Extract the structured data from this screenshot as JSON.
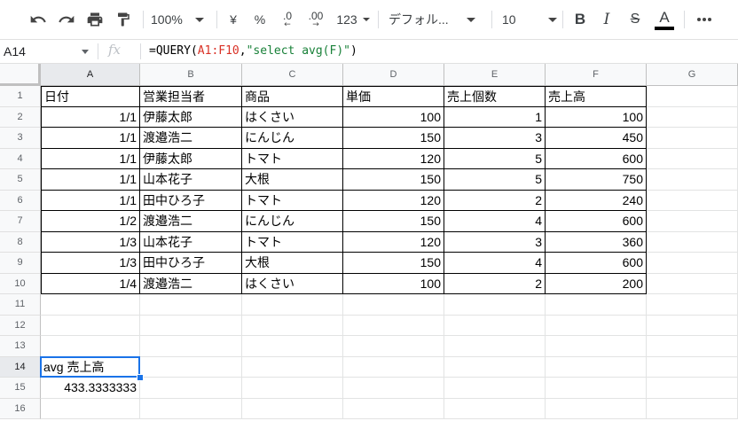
{
  "toolbar": {
    "zoom": "100%",
    "currency": "¥",
    "percent": "%",
    "dec_decrease": ".0",
    "dec_increase": ".00",
    "format_more": "123",
    "font": "デフォル...",
    "font_size": "10",
    "bold": "B",
    "italic": "I",
    "strike": "S",
    "text_color": "A",
    "text_color_value": "#000000"
  },
  "formula_bar": {
    "cell_ref": "A14",
    "fx": "fx",
    "formula_prefix": "=QUERY(",
    "formula_range": "A1:F10",
    "formula_comma": ",",
    "formula_string": "\"select avg(F)\"",
    "formula_suffix": ")"
  },
  "columns": [
    "A",
    "B",
    "C",
    "D",
    "E",
    "F",
    "G"
  ],
  "rows": [
    "1",
    "2",
    "3",
    "4",
    "5",
    "6",
    "7",
    "8",
    "9",
    "10",
    "11",
    "12",
    "13",
    "14",
    "15",
    "16"
  ],
  "table": {
    "header": [
      "日付",
      "営業担当者",
      "商品",
      "単価",
      "売上個数",
      "売上高"
    ],
    "data": [
      [
        "1/1",
        "伊藤太郎",
        "はくさい",
        "100",
        "1",
        "100"
      ],
      [
        "1/1",
        "渡邉浩二",
        "にんじん",
        "150",
        "3",
        "450"
      ],
      [
        "1/1",
        "伊藤太郎",
        "トマト",
        "120",
        "5",
        "600"
      ],
      [
        "1/1",
        "山本花子",
        "大根",
        "150",
        "5",
        "750"
      ],
      [
        "1/1",
        "田中ひろ子",
        "トマト",
        "120",
        "2",
        "240"
      ],
      [
        "1/2",
        "渡邉浩二",
        "にんじん",
        "150",
        "4",
        "600"
      ],
      [
        "1/3",
        "山本花子",
        "トマト",
        "120",
        "3",
        "360"
      ],
      [
        "1/3",
        "田中ひろ子",
        "大根",
        "150",
        "4",
        "600"
      ],
      [
        "1/4",
        "渡邉浩二",
        "はくさい",
        "100",
        "2",
        "200"
      ]
    ]
  },
  "result": {
    "label": "avg 売上高",
    "value": "433.3333333"
  },
  "colors": {
    "selection": "#1a73e8",
    "formula_range": "#d93025",
    "formula_string": "#188038"
  }
}
